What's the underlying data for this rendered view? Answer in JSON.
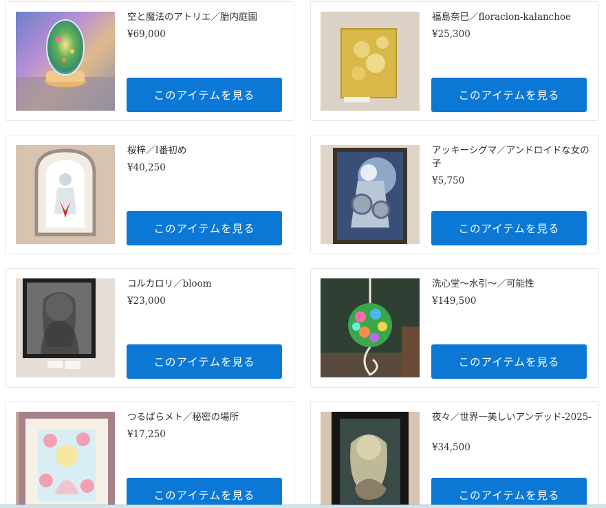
{
  "button_label": "このアイテムを見る",
  "items": [
    {
      "title": "空と魔法のアトリエ／胎内庭園",
      "price": "¥69,000",
      "image": "glass-egg-artwork"
    },
    {
      "title": "福島奈巳／floracion-kalanchoe",
      "price": "¥25,300",
      "image": "yellow-flower-painting"
    },
    {
      "title": "桜梓／I番初め",
      "price": "¥40,250",
      "image": "framed-figure-drawing"
    },
    {
      "title": "アッキーシグマ／アンドロイドな女の子",
      "price": "¥5,750",
      "image": "android-girl-painting"
    },
    {
      "title": "コルカロリ／bloom",
      "price": "¥23,000",
      "image": "framed-monochrome-portrait"
    },
    {
      "title": "洗心堂～水引～／可能性",
      "price": "¥149,500",
      "image": "mizuhiki-flower-ball"
    },
    {
      "title": "つるばらメト／秘密の場所",
      "price": "¥17,250",
      "image": "framed-rose-girl-illustration"
    },
    {
      "title": "夜々／世界一美しいアンデッド-2025-",
      "price": "¥34,500",
      "image": "framed-undead-girl-painting"
    }
  ],
  "colors": {
    "button": "#0b78d6",
    "button_text": "#ffffff",
    "text": "#333333",
    "card_border": "#e6e6e6"
  }
}
